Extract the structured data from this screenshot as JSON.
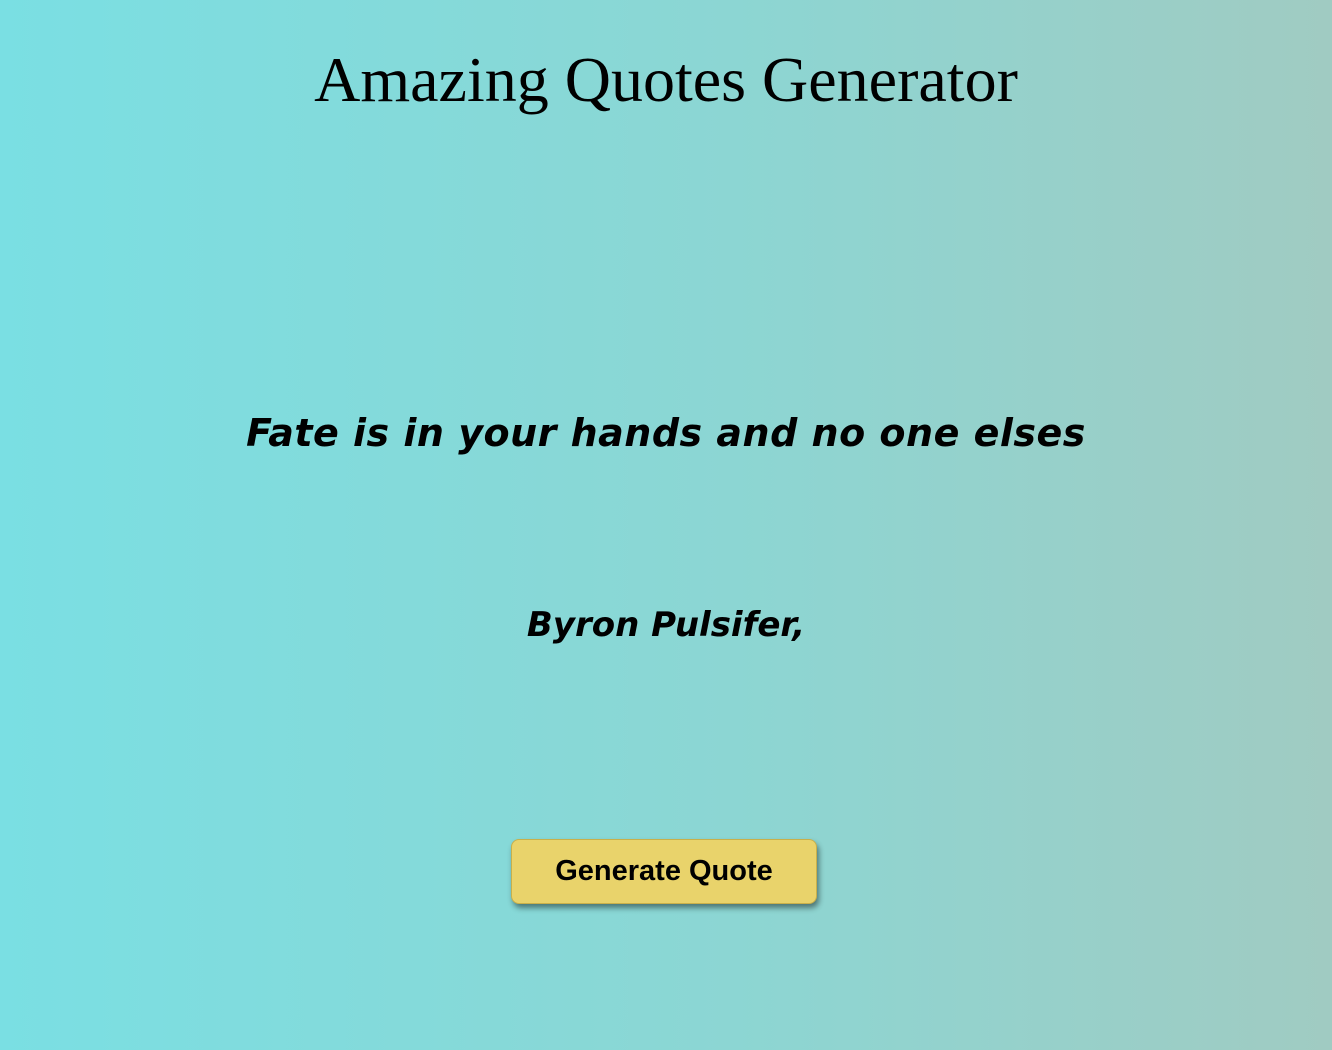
{
  "header": {
    "title": "Amazing Quotes Generator"
  },
  "quote": {
    "text": "Fate is in your hands and no one elses",
    "author": "Byron Pulsifer,"
  },
  "actions": {
    "generate_label": "Generate Quote"
  },
  "colors": {
    "background_start": "#7adfe3",
    "background_end": "#a0cbc2",
    "button": "#e9d36b"
  }
}
